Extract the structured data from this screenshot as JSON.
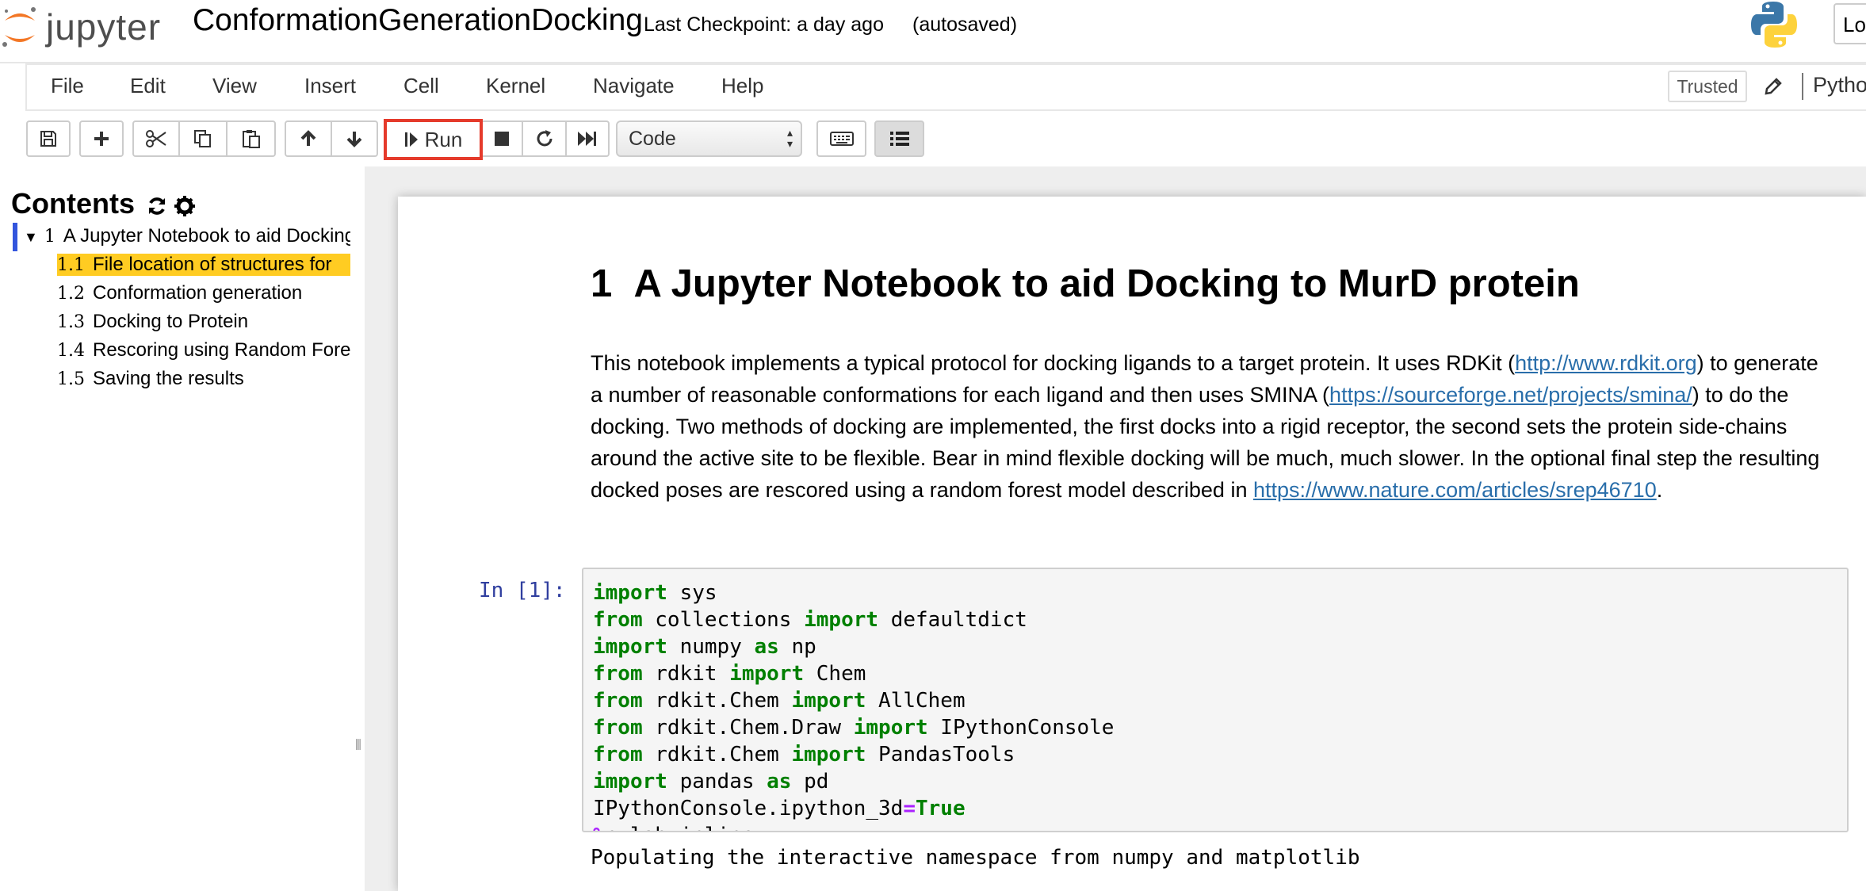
{
  "header": {
    "logo_text": "jupyter",
    "notebook_name": "ConformationGenerationDocking",
    "checkpoint": "Last Checkpoint: a day ago",
    "autosave_status": "(autosaved)",
    "logout_label": "Lo"
  },
  "menubar": {
    "items": [
      "File",
      "Edit",
      "View",
      "Insert",
      "Cell",
      "Kernel",
      "Navigate",
      "Help"
    ],
    "trusted_label": "Trusted",
    "kernel_name": "Pytho"
  },
  "toolbar": {
    "run_label": "Run",
    "cell_type": "Code",
    "highlight_color": "#e53a2b"
  },
  "toc": {
    "title": "Contents",
    "items": [
      {
        "num": "1",
        "label": "A Jupyter Notebook to aid Docking to MurD protein"
      },
      {
        "num": "1.1",
        "label": "File location of structures for"
      },
      {
        "num": "1.2",
        "label": "Conformation generation"
      },
      {
        "num": "1.3",
        "label": "Docking to Protein"
      },
      {
        "num": "1.4",
        "label": "Rescoring using Random Forest"
      },
      {
        "num": "1.5",
        "label": "Saving the results"
      }
    ]
  },
  "content": {
    "heading_num": "1",
    "heading_text": "A Jupyter Notebook to aid Docking to MurD protein",
    "intro": {
      "t1": "This notebook implements a typical protocol for docking ligands to a target protein. It uses RDKit (",
      "link1": "http://www.rdkit.org",
      "t2": ") to generate a number of reasonable conformations for each ligand and then uses SMINA (",
      "link2": "https://sourceforge.net/projects/smina/",
      "t3": ") to do the docking. Two methods of docking are implemented, the first docks into a rigid receptor, the second sets the protein side-chains around the active site to be flexible. Bear in mind flexible docking will be much, much slower. In the optional final step the resulting docked poses are rescored using a random forest model described in ",
      "link3": "https://www.nature.com/articles/srep46710",
      "t4": "."
    },
    "cell": {
      "prompt": "In [1]:",
      "output": "Populating the interactive namespace from numpy and matplotlib"
    }
  },
  "colors": {
    "toc_highlight": "#ffcc22",
    "link": "#296eaa",
    "keyword": "#008000",
    "prompt": "#303f9f"
  }
}
